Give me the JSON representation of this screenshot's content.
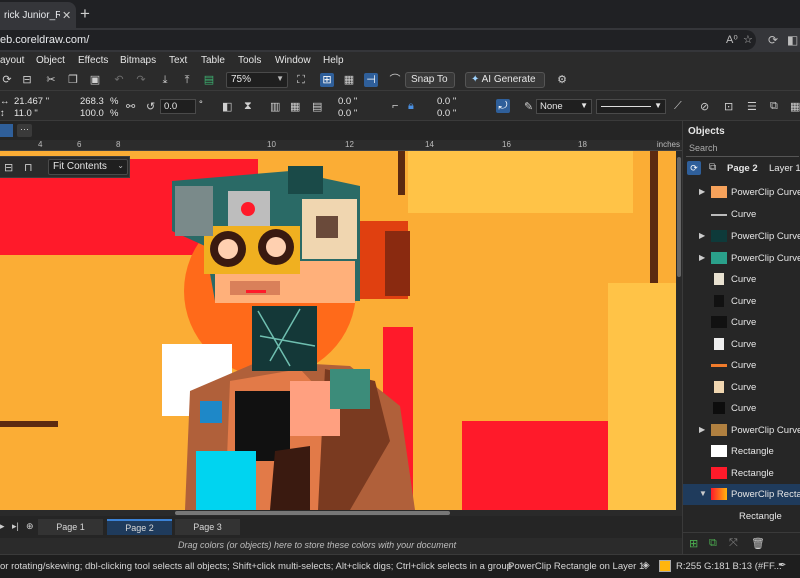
{
  "browser": {
    "tab_title": "rick Junior_Robc",
    "tab_close": "✕",
    "new_tab": "+",
    "url": "eb.coreldraw.com/",
    "omni_icons": [
      "A⁰",
      "☆"
    ]
  },
  "menu": [
    "ayout",
    "Object",
    "Effects",
    "Bitmaps",
    "Text",
    "Table",
    "Tools",
    "Window",
    "Help"
  ],
  "toolbar": {
    "zoom": "75%",
    "snap_to": "Snap To",
    "ai_generate": "AI Generate"
  },
  "propbar": {
    "x": "21.467 \"",
    "y": "11.0 \"",
    "w_pct": "268.3",
    "h_pct": "100.0",
    "pct_sign": "%",
    "rotation": "0.0",
    "deg": "°",
    "skew1": "0.0 \"",
    "skew2": "0.0 \"",
    "pos1": "0.0 \"",
    "pos2": "0.0 \"",
    "outline": "None"
  },
  "docmore": "···",
  "ruler": {
    "ticks": [
      "4",
      "6",
      "8",
      "10",
      "12",
      "14",
      "16",
      "18"
    ],
    "unit": "inches"
  },
  "floatbar": {
    "fit": "Fit Contents"
  },
  "pages": [
    "Page 1",
    "Page 2",
    "Page 3"
  ],
  "palette_msg": "Drag colors (or objects) here to store these colors with your document",
  "status": {
    "message": "or rotating/skewing; dbl-clicking tool selects all objects; Shift+click multi-selects; Alt+click digs; Ctrl+click selects in a group",
    "object": "PowerClip Rectangle on Layer 1",
    "fill": "R:255 G:181 B:13 (#FF..."
  },
  "objects": {
    "title": "Objects",
    "search": "Search",
    "page": "Page 2",
    "layer": "Layer 1",
    "items": [
      {
        "label": "PowerClip Curve",
        "expand": "▶",
        "thumb": "#f6a25b"
      },
      {
        "label": "Curve",
        "expand": "",
        "thumb": "#bbbbbb"
      },
      {
        "label": "PowerClip Curve",
        "expand": "▶",
        "thumb": "#0e3a3a"
      },
      {
        "label": "PowerClip Curve",
        "expand": "▶",
        "thumb": "#2aa08a"
      },
      {
        "label": "Curve",
        "expand": "",
        "thumb": "#e8e1d0"
      },
      {
        "label": "Curve",
        "expand": "",
        "thumb": "#111111"
      },
      {
        "label": "Curve",
        "expand": "",
        "thumb": "#111111"
      },
      {
        "label": "Curve",
        "expand": "",
        "thumb": "#eeeeee"
      },
      {
        "label": "Curve",
        "expand": "",
        "thumb": "#f07b2b"
      },
      {
        "label": "Curve",
        "expand": "",
        "thumb": "#f0d6b0"
      },
      {
        "label": "Curve",
        "expand": "",
        "thumb": "#0d0d0d"
      },
      {
        "label": "PowerClip Curve",
        "expand": "▶",
        "thumb": "#b08040"
      },
      {
        "label": "Rectangle",
        "expand": "",
        "thumb": "#ffffff"
      },
      {
        "label": "Rectangle",
        "expand": "",
        "thumb": "#ff1a2a"
      },
      {
        "label": "PowerClip Rectang",
        "expand": "▼",
        "thumb": "#ff7a20"
      },
      {
        "label": "Rectangle",
        "expand": "",
        "thumb": ""
      }
    ]
  },
  "colors": {
    "canvas_bg": "#fbad35",
    "accent": "#2f5f9a",
    "red": "#ff1a2a"
  }
}
